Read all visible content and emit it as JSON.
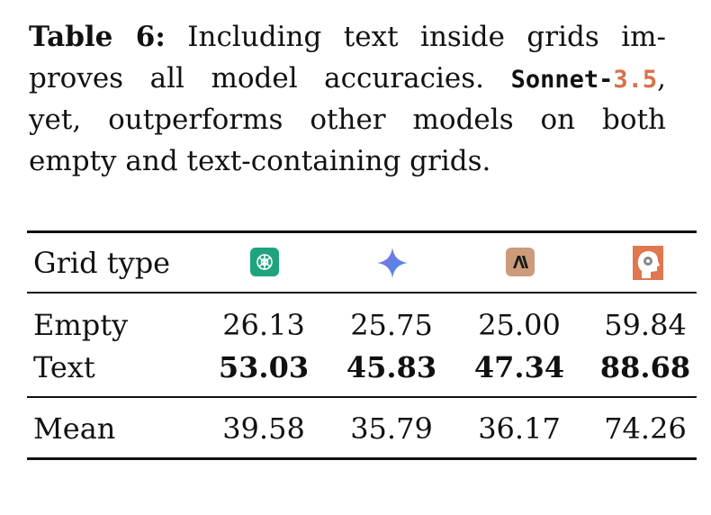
{
  "caption": {
    "label": "Table 6:",
    "line1": " Including text inside grids im-",
    "line2a": "proves all model accuracies. ",
    "model_prefix": "Sonnet-",
    "model_version": "3.5",
    "line2b": ",",
    "line3": "yet, outperforms other models on both",
    "line4": "empty and text-containing grids."
  },
  "table": {
    "header": "Grid type",
    "model_icons": [
      "openai-icon",
      "gemini-icon",
      "anthropic-icon",
      "human-head-icon"
    ],
    "rows": [
      {
        "label": "Empty",
        "values": [
          "26.13",
          "25.75",
          "25.00",
          "59.84"
        ],
        "bold": false
      },
      {
        "label": "Text",
        "values": [
          "53.03",
          "45.83",
          "47.34",
          "88.68"
        ],
        "bold": true
      },
      {
        "label": "Mean",
        "values": [
          "39.58",
          "35.79",
          "36.17",
          "74.26"
        ],
        "bold": false
      }
    ]
  },
  "colors": {
    "accent": "#d9704a",
    "openai": "#1fa37f",
    "anthropic": "#cc9b7a",
    "human": "#e0774f"
  }
}
